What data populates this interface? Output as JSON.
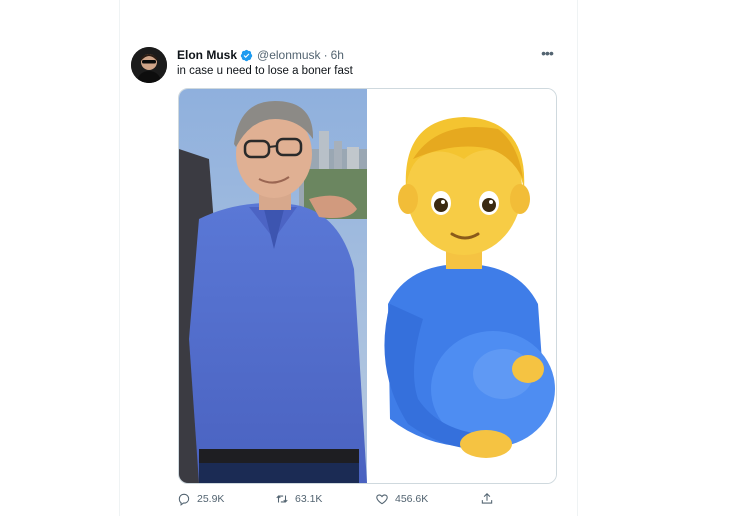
{
  "tweet": {
    "author_name": "Elon Musk",
    "handle": "@elonmusk",
    "separator": "·",
    "time": "6h",
    "text": "in case u need to lose a boner fast",
    "verified_icon": "verified-badge-icon",
    "more_icon": "more-options-icon"
  },
  "media": {
    "left_image": "photo-of-man-in-blue-polo",
    "right_image": "pregnant-man-emoji"
  },
  "stats": {
    "replies": "25.9K",
    "retweets": "63.1K",
    "likes": "456.6K"
  },
  "colors": {
    "verified": "#1d9bf0",
    "text_primary": "#0f1419",
    "text_secondary": "#536471",
    "border": "#cfd9de"
  }
}
